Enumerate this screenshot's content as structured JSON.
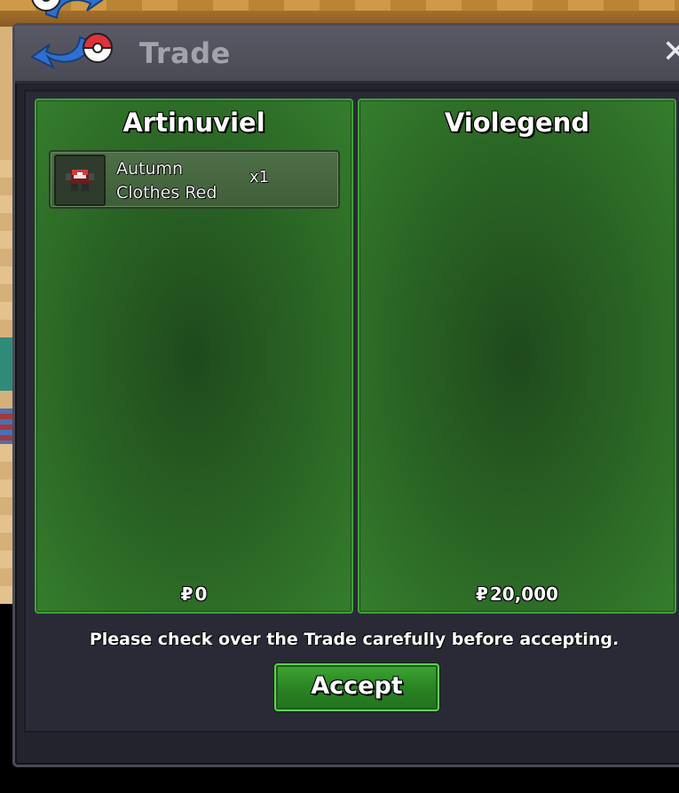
{
  "window": {
    "title": "Trade",
    "close_glyph": "✕",
    "logo_icon": "trade-pokeball-swap-icon"
  },
  "players": [
    {
      "name": "Artinuviel",
      "items": [
        {
          "name": "Autumn Clothes Red",
          "quantity": "x1",
          "icon": "clothes-red-icon"
        }
      ],
      "currency_symbol": "₽",
      "money": "0"
    },
    {
      "name": "Violegend",
      "items": [],
      "currency_symbol": "₽",
      "money": "20,000"
    }
  ],
  "notice": "Please check over the Trade carefully before accepting.",
  "accept_label": "Accept",
  "colors": {
    "panel_green": "#2a6524",
    "panel_border": "#3fa33a",
    "accept_green": "#2a8424",
    "window_bg": "#23232d",
    "titlebar": "#4f4f5a"
  }
}
